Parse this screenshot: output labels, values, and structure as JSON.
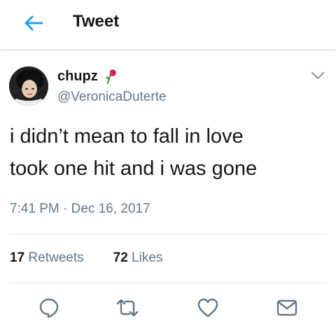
{
  "header": {
    "title": "Tweet",
    "back_icon": "arrow-left-icon"
  },
  "tweet": {
    "display_name": "chupz",
    "handle": "@VeronicaDuterte",
    "emoji_icon": "wilted-rose-icon",
    "lines": [
      "i didn’t mean to fall in love",
      "took one hit and i was gone"
    ],
    "time": "7:41 PM",
    "separator": " · ",
    "date": "Dec 16, 2017",
    "retweets": {
      "count": "17",
      "label": "Retweets"
    },
    "likes": {
      "count": "72",
      "label": "Likes"
    }
  },
  "actions": [
    {
      "icon": "reply-icon"
    },
    {
      "icon": "retweet-icon"
    },
    {
      "icon": "like-heart-icon"
    },
    {
      "icon": "direct-message-icon"
    }
  ],
  "colors": {
    "accent": "#1da1f2",
    "text": "#14171a",
    "secondary": "#657786",
    "divider": "#e1e8ed"
  }
}
